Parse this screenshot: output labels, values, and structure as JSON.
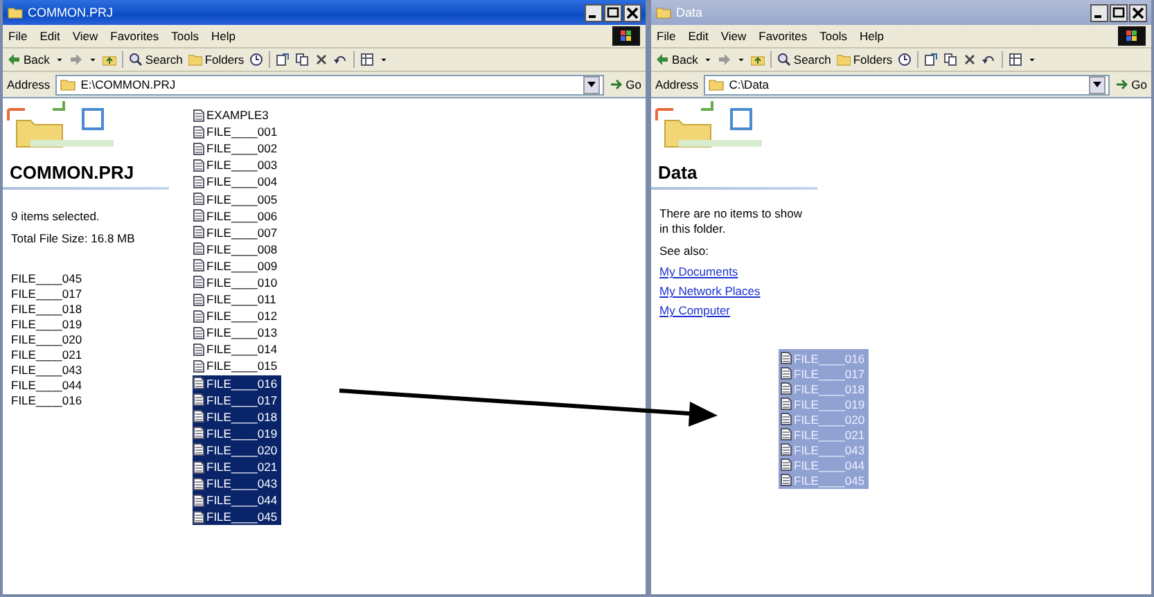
{
  "windows": [
    {
      "title": "COMMON.PRJ",
      "active": true,
      "menu": [
        "File",
        "Edit",
        "View",
        "Favorites",
        "Tools",
        "Help"
      ],
      "toolbar": {
        "back": "Back",
        "search": "Search",
        "folders": "Folders"
      },
      "address_label": "Address",
      "address": "E:\\COMMON.PRJ",
      "go": "Go",
      "pane": {
        "heading": "COMMON.PRJ",
        "texts": [
          "9 items selected.",
          "Total File Size: 16.8 MB"
        ],
        "list": [
          "FILE____045",
          "FILE____017",
          "FILE____018",
          "FILE____019",
          "FILE____020",
          "FILE____021",
          "FILE____043",
          "FILE____044",
          "FILE____016"
        ]
      },
      "files": [
        {
          "name": "EXAMPLE3",
          "selected": false
        },
        {
          "name": "FILE____001",
          "selected": false
        },
        {
          "name": "FILE____002",
          "selected": false
        },
        {
          "name": "FILE____003",
          "selected": false
        },
        {
          "name": "FILE____004",
          "selected": false
        },
        {
          "name": "FILE____005",
          "selected": false
        },
        {
          "name": "FILE____006",
          "selected": false
        },
        {
          "name": "FILE____007",
          "selected": false
        },
        {
          "name": "FILE____008",
          "selected": false
        },
        {
          "name": "FILE____009",
          "selected": false
        },
        {
          "name": "FILE____010",
          "selected": false
        },
        {
          "name": "FILE____011",
          "selected": false
        },
        {
          "name": "FILE____012",
          "selected": false
        },
        {
          "name": "FILE____013",
          "selected": false
        },
        {
          "name": "FILE____014",
          "selected": false
        },
        {
          "name": "FILE____015",
          "selected": false
        },
        {
          "name": "FILE____016",
          "selected": true
        },
        {
          "name": "FILE____017",
          "selected": true
        },
        {
          "name": "FILE____018",
          "selected": true
        },
        {
          "name": "FILE____019",
          "selected": true
        },
        {
          "name": "FILE____020",
          "selected": true
        },
        {
          "name": "FILE____021",
          "selected": true
        },
        {
          "name": "FILE____043",
          "selected": true
        },
        {
          "name": "FILE____044",
          "selected": true
        },
        {
          "name": "FILE____045",
          "selected": true
        }
      ]
    },
    {
      "title": "Data",
      "active": false,
      "menu": [
        "File",
        "Edit",
        "View",
        "Favorites",
        "Tools",
        "Help"
      ],
      "toolbar": {
        "back": "Back",
        "search": "Search",
        "folders": "Folders"
      },
      "address_label": "Address",
      "address": "C:\\Data",
      "go": "Go",
      "pane": {
        "heading": "Data",
        "texts": [
          "There are no items to show in this folder.",
          "See also:"
        ],
        "links": [
          "My Documents",
          "My Network Places",
          "My Computer"
        ]
      },
      "drag_ghost": [
        "FILE____016",
        "FILE____017",
        "FILE____018",
        "FILE____019",
        "FILE____020",
        "FILE____021",
        "FILE____043",
        "FILE____044",
        "FILE____045"
      ]
    }
  ]
}
